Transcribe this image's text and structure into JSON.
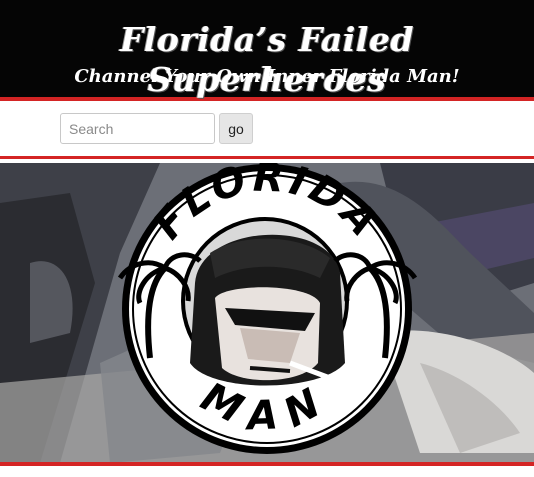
{
  "header": {
    "title": "Florida’s Failed Superheroes",
    "tagline": "Channel Your Own Inner Florida Man!"
  },
  "search": {
    "placeholder": "Search",
    "value": "",
    "button_label": "go"
  },
  "banner": {
    "logo": {
      "top_text": "FLORIDA",
      "bottom_text": "MAN"
    }
  },
  "colors": {
    "header_bg": "#050505",
    "accent_red": "#d42424",
    "title_text": "#ffffff"
  },
  "icons": [
    "palm-tree-icon",
    "florida-man-logo"
  ]
}
